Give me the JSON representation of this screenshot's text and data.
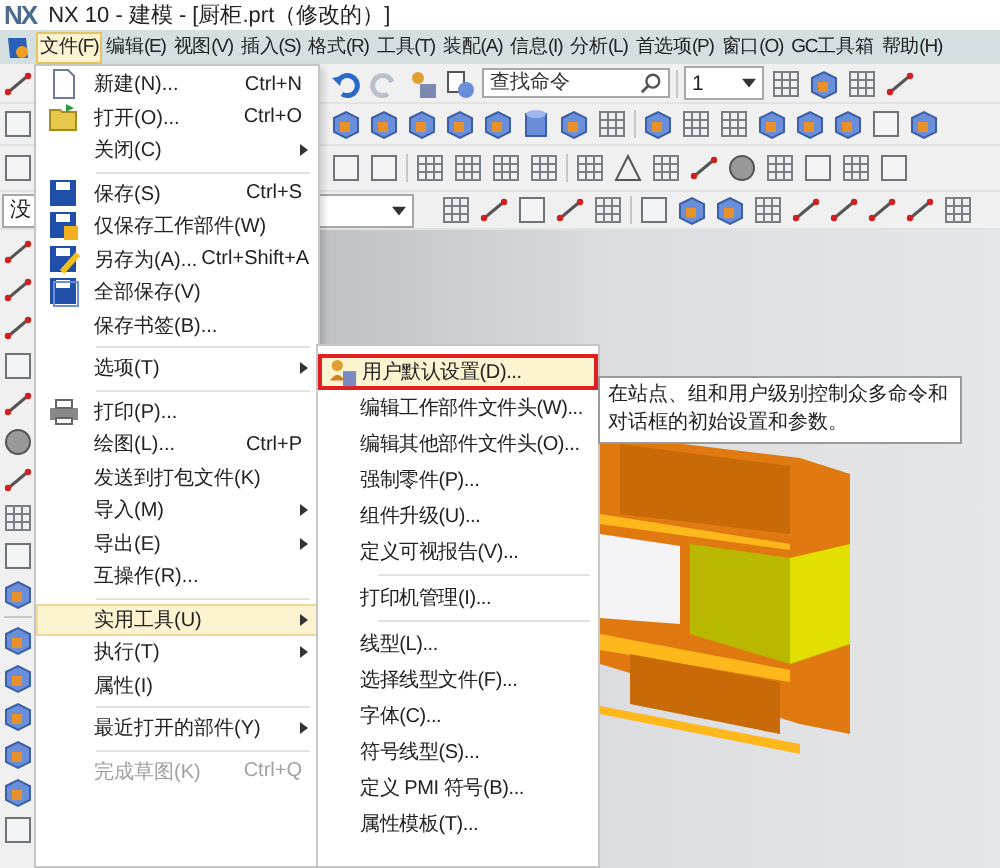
{
  "window": {
    "logo": "NX",
    "title": "NX 10 - 建模 - [厨柜.prt（修改的）]"
  },
  "menu_bar": [
    {
      "label": "文件(F)",
      "selected": true
    },
    {
      "label": "编辑(E)",
      "selected": false
    },
    {
      "label": "视图(V)",
      "selected": false
    },
    {
      "label": "插入(S)",
      "selected": false
    },
    {
      "label": "格式(R)",
      "selected": false
    },
    {
      "label": "工具(T)",
      "selected": false
    },
    {
      "label": "装配(A)",
      "selected": false
    },
    {
      "label": "信息(I)",
      "selected": false
    },
    {
      "label": "分析(L)",
      "selected": false
    },
    {
      "label": "首选项(P)",
      "selected": false
    },
    {
      "label": "窗口(O)",
      "selected": false
    },
    {
      "label": "GC工具箱",
      "selected": false
    },
    {
      "label": "帮助(H)",
      "selected": false
    }
  ],
  "toolbar": {
    "search": {
      "placeholder": "查找命令"
    },
    "layer_dropdown": {
      "value": "1"
    },
    "filter_dropdown": {
      "value": "没"
    }
  },
  "file_menu": [
    {
      "kind": "item",
      "label": "新建(N)...",
      "shortcut": "Ctrl+N",
      "submenu": false,
      "highlighted": false,
      "disabled": false
    },
    {
      "kind": "item",
      "label": "打开(O)...",
      "shortcut": "Ctrl+O",
      "submenu": false,
      "highlighted": false,
      "disabled": false
    },
    {
      "kind": "item",
      "label": "关闭(C)",
      "submenu": true,
      "highlighted": false,
      "disabled": false
    },
    {
      "kind": "separator"
    },
    {
      "kind": "item",
      "label": "保存(S)",
      "shortcut": "Ctrl+S",
      "submenu": false,
      "highlighted": false,
      "disabled": false
    },
    {
      "kind": "item",
      "label": "仅保存工作部件(W)",
      "submenu": false,
      "highlighted": false,
      "disabled": false
    },
    {
      "kind": "item",
      "label": "另存为(A)...",
      "shortcut": "Ctrl+Shift+A",
      "submenu": false,
      "highlighted": false,
      "disabled": false
    },
    {
      "kind": "item",
      "label": "全部保存(V)",
      "submenu": false,
      "highlighted": false,
      "disabled": false
    },
    {
      "kind": "item",
      "label": "保存书签(B)...",
      "submenu": false,
      "highlighted": false,
      "disabled": false
    },
    {
      "kind": "separator"
    },
    {
      "kind": "item",
      "label": "选项(T)",
      "submenu": true,
      "highlighted": false,
      "disabled": false
    },
    {
      "kind": "separator"
    },
    {
      "kind": "item",
      "label": "打印(P)...",
      "submenu": false,
      "highlighted": false,
      "disabled": false
    },
    {
      "kind": "item",
      "label": "绘图(L)...",
      "shortcut": "Ctrl+P",
      "submenu": false,
      "highlighted": false,
      "disabled": false
    },
    {
      "kind": "item",
      "label": "发送到打包文件(K)",
      "submenu": false,
      "highlighted": false,
      "disabled": false
    },
    {
      "kind": "item",
      "label": "导入(M)",
      "submenu": true,
      "highlighted": false,
      "disabled": false
    },
    {
      "kind": "item",
      "label": "导出(E)",
      "submenu": true,
      "highlighted": false,
      "disabled": false
    },
    {
      "kind": "item",
      "label": "互操作(R)...",
      "submenu": false,
      "highlighted": false,
      "disabled": false
    },
    {
      "kind": "separator"
    },
    {
      "kind": "item",
      "label": "实用工具(U)",
      "submenu": true,
      "highlighted": true,
      "disabled": false
    },
    {
      "kind": "item",
      "label": "执行(T)",
      "submenu": true,
      "highlighted": false,
      "disabled": false
    },
    {
      "kind": "item",
      "label": "属性(I)",
      "submenu": false,
      "highlighted": false,
      "disabled": false
    },
    {
      "kind": "separator"
    },
    {
      "kind": "item",
      "label": "最近打开的部件(Y)",
      "submenu": true,
      "highlighted": false,
      "disabled": false
    },
    {
      "kind": "separator"
    },
    {
      "kind": "item",
      "label": "完成草图(K)",
      "shortcut": "Ctrl+Q",
      "submenu": false,
      "highlighted": false,
      "disabled": true
    }
  ],
  "utilities_submenu": [
    {
      "kind": "item",
      "label": "用户默认设置(D)...",
      "highlighted": true,
      "outlined": true
    },
    {
      "kind": "item",
      "label": "编辑工作部件文件头(W)...",
      "highlighted": false,
      "outlined": false
    },
    {
      "kind": "item",
      "label": "编辑其他部件文件头(O)...",
      "highlighted": false,
      "outlined": false
    },
    {
      "kind": "item",
      "label": "强制零件(P)...",
      "highlighted": false,
      "outlined": false
    },
    {
      "kind": "item",
      "label": "组件升级(U)...",
      "highlighted": false,
      "outlined": false
    },
    {
      "kind": "item",
      "label": "定义可视报告(V)...",
      "highlighted": false,
      "outlined": false
    },
    {
      "kind": "separator"
    },
    {
      "kind": "item",
      "label": "打印机管理(I)...",
      "highlighted": false,
      "outlined": false
    },
    {
      "kind": "separator"
    },
    {
      "kind": "item",
      "label": "线型(L)...",
      "highlighted": false,
      "outlined": false
    },
    {
      "kind": "item",
      "label": "选择线型文件(F)...",
      "highlighted": false,
      "outlined": false
    },
    {
      "kind": "item",
      "label": "字体(C)...",
      "highlighted": false,
      "outlined": false
    },
    {
      "kind": "item",
      "label": "符号线型(S)...",
      "highlighted": false,
      "outlined": false
    },
    {
      "kind": "item",
      "label": "定义 PMI 符号(B)...",
      "highlighted": false,
      "outlined": false
    },
    {
      "kind": "item",
      "label": "属性模板(T)...",
      "highlighted": false,
      "outlined": false
    }
  ],
  "tooltip": {
    "text": "在站点、组和用户级别控制众多命令和对话框的初始设置和参数。"
  }
}
